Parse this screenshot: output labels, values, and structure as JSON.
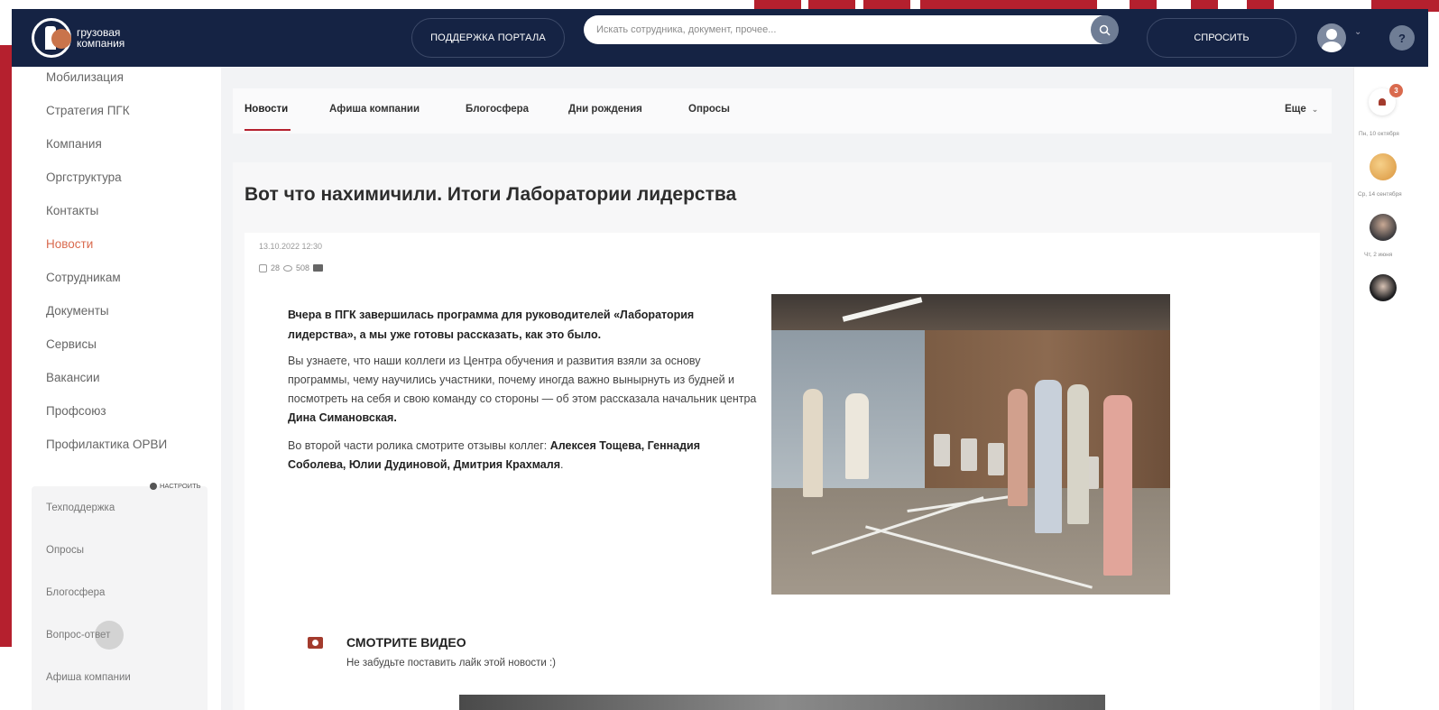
{
  "header": {
    "logo_line1": "грузовая",
    "logo_line2": "компания",
    "support_label": "ПОДДЕРЖКА ПОРТАЛА",
    "search_placeholder": "Искать сотрудника, документ, прочее...",
    "ask_label": "СПРОСИТЬ",
    "help_glyph": "?"
  },
  "sidebar": {
    "items": [
      {
        "label": "Мобилизация"
      },
      {
        "label": "Стратегия ПГК"
      },
      {
        "label": "Компания"
      },
      {
        "label": "Оргструктура"
      },
      {
        "label": "Контакты"
      },
      {
        "label": "Новости"
      },
      {
        "label": "Сотрудникам"
      },
      {
        "label": "Документы"
      },
      {
        "label": "Сервисы"
      },
      {
        "label": "Вакансии"
      },
      {
        "label": "Профсоюз"
      },
      {
        "label": "Профилактика ОРВИ"
      }
    ],
    "active_index": 5,
    "configure_label": "НАСТРОИТЬ",
    "quick_links": [
      {
        "label": "Техподдержка"
      },
      {
        "label": "Опросы"
      },
      {
        "label": "Блогосфера"
      },
      {
        "label": "Вопрос-ответ"
      },
      {
        "label": "Афиша компании"
      }
    ]
  },
  "tabs": {
    "items": [
      {
        "label": "Новости"
      },
      {
        "label": "Афиша компании"
      },
      {
        "label": "Блогосфера"
      },
      {
        "label": "Дни рождения"
      },
      {
        "label": "Опросы"
      }
    ],
    "more_label": "Еще"
  },
  "article": {
    "title": "Вот что нахимичили. Итоги Лаборатории лидерства",
    "date": "13.10.2022 12:30",
    "likes": "28",
    "views": "508",
    "lead": "Вчера в ПГК завершилась программа для руководителей «Лаборатория лидерства», а мы уже готовы рассказать, как это было.",
    "para1": "Вы узнаете, что наши коллеги из Центра обучения и развития взяли за основу программы, чему научились участники, почему иногда важно вынырнуть из будней и посмотреть на себя и свою команду со стороны — об этом рассказала начальник центра",
    "para1_bold": "Дина Симановская.",
    "para2": "Во второй части ролика смотрите отзывы коллег:",
    "para2_bold": "Алексея Тощева, Геннадия Соболева, Юлии Дудиновой, Дмитрия Крахмаля",
    "para2_end": ".",
    "video_title": "СМОТРИТЕ ВИДЕО",
    "video_sub": "Не забудьте поставить лайк этой новости :)"
  },
  "rail": {
    "notification_count": "3",
    "dates": [
      "Пн, 10 октября",
      "Ср, 14 сентября",
      "Чт, 2 июня"
    ]
  },
  "colors": {
    "brand_navy": "#152344",
    "accent_red": "#b5202e",
    "active_orange": "#d96a4e"
  }
}
